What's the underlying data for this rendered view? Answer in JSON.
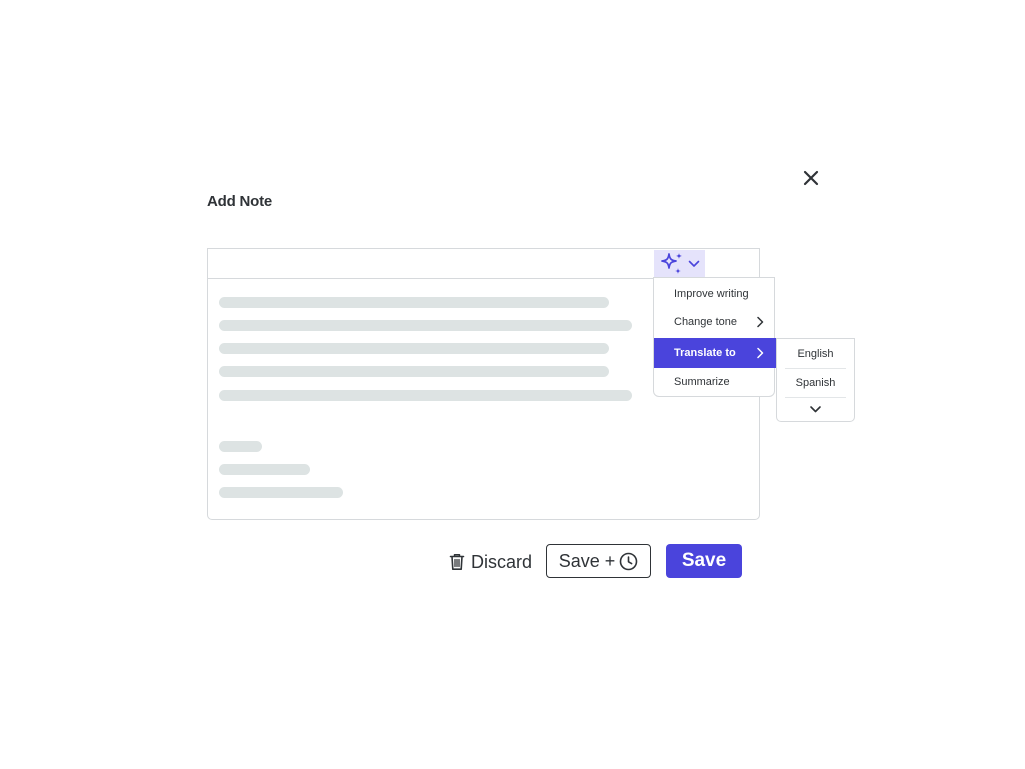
{
  "dialog": {
    "title": "Add Note"
  },
  "ai_menu": {
    "items": [
      {
        "label": "Improve writing",
        "has_submenu": false
      },
      {
        "label": "Change tone",
        "has_submenu": true
      },
      {
        "label": "Translate to",
        "has_submenu": true,
        "active": true
      },
      {
        "label": "Summarize",
        "has_submenu": false
      }
    ]
  },
  "translate_submenu": {
    "languages": [
      "English",
      "Spanish"
    ]
  },
  "actions": {
    "discard_label": "Discard",
    "save_later_label": "Save +",
    "save_label": "Save"
  },
  "colors": {
    "accent": "#4a44dc",
    "accent_light": "#e5e3fb",
    "skeleton": "#dde3e3",
    "border": "#d6d9dc"
  },
  "icons": {
    "close": "close-icon",
    "ai_sparkle": "sparkles-icon",
    "dropdown": "chevron-down-icon",
    "submenu": "chevron-right-icon",
    "discard": "trash-icon",
    "schedule": "clock-icon"
  }
}
